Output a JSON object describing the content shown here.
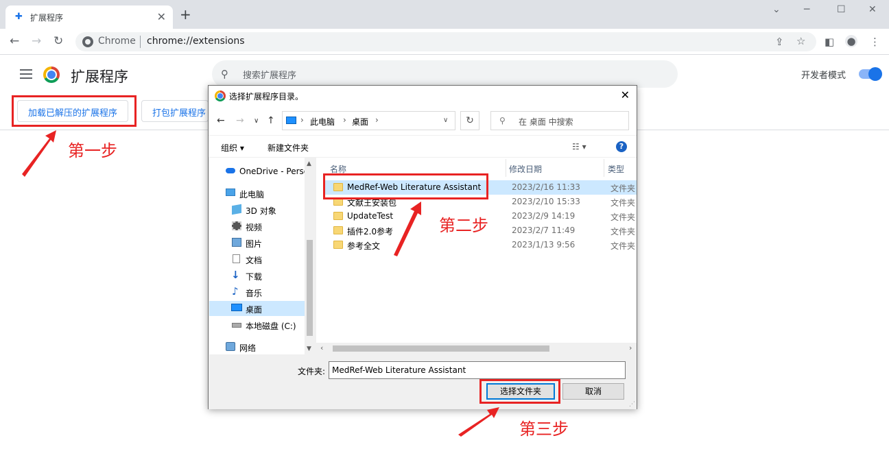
{
  "browser": {
    "tab_title": "扩展程序",
    "tab_close": "✕",
    "new_tab": "+",
    "omnibox_scheme": "Chrome",
    "omnibox_url": "chrome://extensions"
  },
  "page": {
    "title": "扩展程序",
    "search_placeholder": "搜索扩展程序",
    "dev_mode_label": "开发者模式",
    "dev_mode_on": true,
    "load_unpacked_label": "加载已解压的扩展程序",
    "pack_label": "打包扩展程序"
  },
  "annotations": {
    "step1": "第一步",
    "step2": "第二步",
    "step3": "第三步",
    "color": "#e82323"
  },
  "dialog": {
    "title": "选择扩展程序目录。",
    "close": "✕",
    "breadcrumb": [
      "此电脑",
      "桌面"
    ],
    "search_placeholder": "在 桌面 中搜索",
    "organize_label": "组织 ▾",
    "new_folder_label": "新建文件夹",
    "help": "?",
    "nav_items": [
      {
        "label": "OneDrive - Personal",
        "icon": "cloud-icon"
      },
      {
        "label": "此电脑",
        "icon": "computer-icon"
      },
      {
        "label": "3D 对象",
        "icon": "3d-objects-icon"
      },
      {
        "label": "视频",
        "icon": "video-icon"
      },
      {
        "label": "图片",
        "icon": "pictures-icon"
      },
      {
        "label": "文档",
        "icon": "documents-icon"
      },
      {
        "label": "下载",
        "icon": "download-icon"
      },
      {
        "label": "音乐",
        "icon": "music-icon"
      },
      {
        "label": "桌面",
        "icon": "desktop-icon"
      },
      {
        "label": "本地磁盘 (C:)",
        "icon": "drive-icon"
      },
      {
        "label": "网络",
        "icon": "network-icon"
      }
    ],
    "columns": {
      "name": "名称",
      "date": "修改日期",
      "type": "类型"
    },
    "files": [
      {
        "name": "MedRef-Web Literature Assistant",
        "date": "2023/2/16 11:33",
        "type": "文件夹"
      },
      {
        "name": "文献王安装包",
        "date": "2023/2/10 15:33",
        "type": "文件夹"
      },
      {
        "name": "UpdateTest",
        "date": "2023/2/9 14:19",
        "type": "文件夹"
      },
      {
        "name": "插件2.0参考",
        "date": "2023/2/7 11:49",
        "type": "文件夹"
      },
      {
        "name": "参考全文",
        "date": "2023/1/13 9:56",
        "type": "文件夹"
      }
    ],
    "folder_label": "文件夹:",
    "folder_value": "MedRef-Web Literature Assistant",
    "select_button": "选择文件夹",
    "cancel_button": "取消"
  }
}
